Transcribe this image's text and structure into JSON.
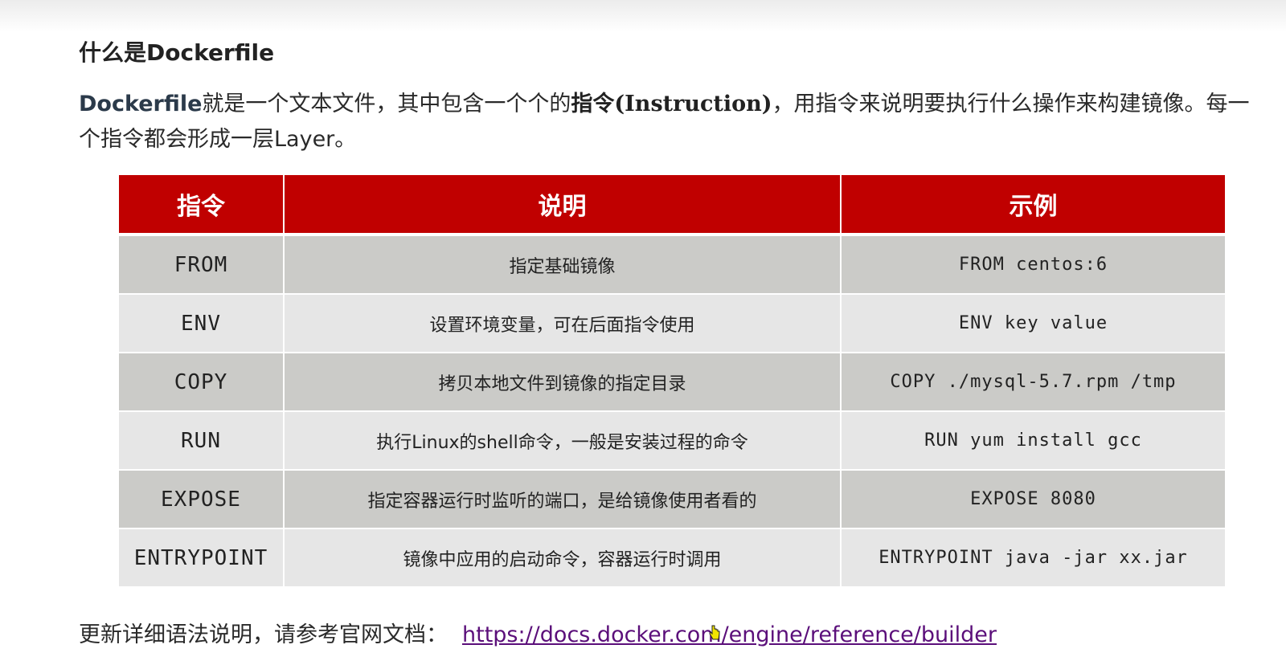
{
  "heading": "什么是Dockerfile",
  "intro": {
    "part1_bold": "Dockerfile",
    "part2": "就是一个文本文件，其中包含一个个的",
    "part3_bold": "指令(Instruction)",
    "part4": "，用指令来说明要执行什么操作来构建镜像。每一个指令都会形成一层Layer。"
  },
  "table": {
    "headers": [
      "指令",
      "说明",
      "示例"
    ],
    "rows": [
      {
        "cmd": "FROM",
        "desc": "指定基础镜像",
        "example": "FROM centos:6"
      },
      {
        "cmd": "ENV",
        "desc": "设置环境变量，可在后面指令使用",
        "example": "ENV key value"
      },
      {
        "cmd": "COPY",
        "desc": "拷贝本地文件到镜像的指定目录",
        "example": "COPY ./mysql-5.7.rpm /tmp"
      },
      {
        "cmd": "RUN",
        "desc": "执行Linux的shell命令，一般是安装过程的命令",
        "example": "RUN yum install gcc"
      },
      {
        "cmd": "EXPOSE",
        "desc": "指定容器运行时监听的端口，是给镜像使用者看的",
        "example": "EXPOSE 8080"
      },
      {
        "cmd": "ENTRYPOINT",
        "desc": "镜像中应用的启动命令，容器运行时调用",
        "example": "ENTRYPOINT java -jar xx.jar"
      }
    ]
  },
  "footer": {
    "text": "更新详细语法说明，请参考官网文档：",
    "link": "https://docs.docker.com/engine/reference/builder"
  },
  "colors": {
    "header_bg": "#c00000",
    "row_dark": "#cbcbc8",
    "row_light": "#e6e6e6",
    "link": "#5b0f7a"
  }
}
